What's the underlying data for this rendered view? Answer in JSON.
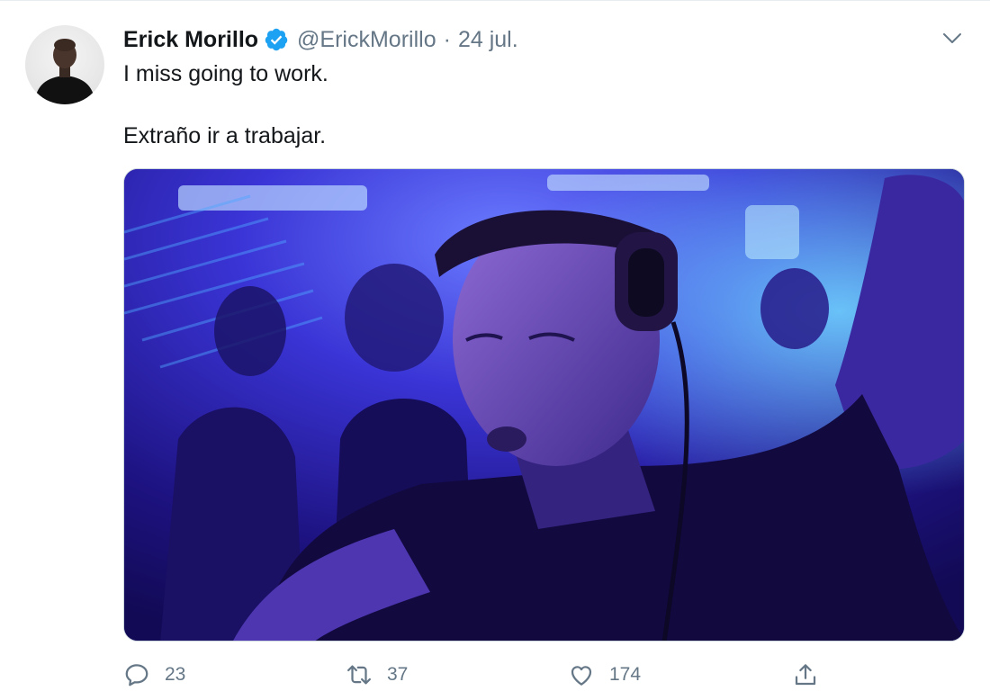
{
  "author": {
    "display_name": "Erick Morillo",
    "handle": "@ErickMorillo",
    "separator": "·",
    "date": "24 jul.",
    "verified": true,
    "avatar_icon": "profile-photo"
  },
  "tweet": {
    "lines": [
      "I miss going to work.",
      "Extraño ir a trabajar."
    ]
  },
  "media": {
    "kind": "photo",
    "icon": "photo-dj-headphones"
  },
  "actions": {
    "reply_count": "23",
    "retweet_count": "37",
    "like_count": "174",
    "reply_icon": "speech-bubble-icon",
    "retweet_icon": "retweet-arrows-icon",
    "like_icon": "heart-icon",
    "share_icon": "share-icon"
  },
  "colors": {
    "verified": "#1da1f2",
    "secondary_text": "#657786",
    "primary_text": "#14171a",
    "divider": "#e6ecf0"
  }
}
